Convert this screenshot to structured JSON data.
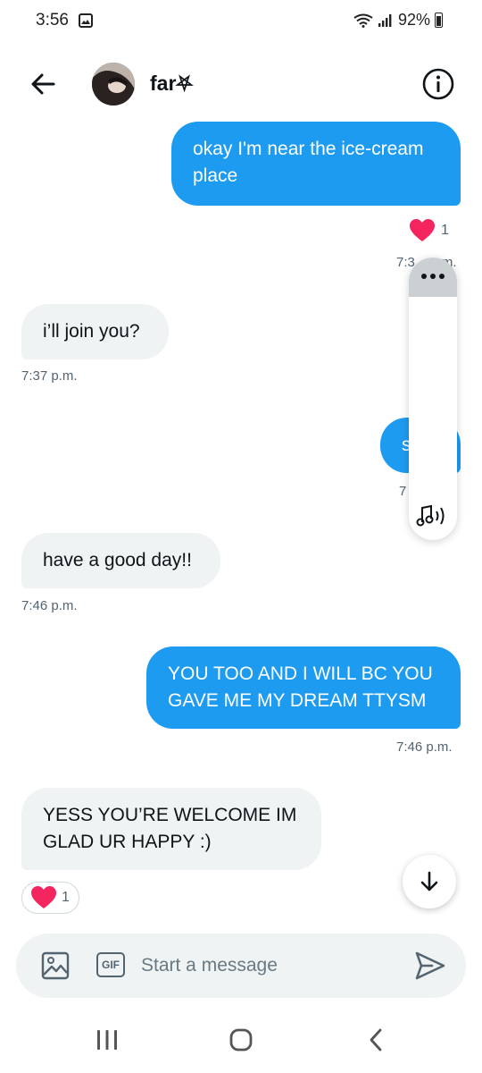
{
  "status_bar": {
    "time": "3:56",
    "battery": "92%"
  },
  "header": {
    "name": "far⛧",
    "back_icon": "arrow-left-icon",
    "info_icon": "info-icon"
  },
  "messages": [
    {
      "text": "okay I'm near the ice-cream place",
      "direction": "outgoing",
      "time": "7:3",
      "time_suffix": "m.",
      "reaction": {
        "icon": "heart-icon",
        "count": "1"
      }
    },
    {
      "text": "i’ll join you?",
      "direction": "incoming",
      "time": "7:37 p.m."
    },
    {
      "text": "s",
      "direction": "outgoing",
      "time": "7"
    },
    {
      "text": "have a good day!!",
      "direction": "incoming",
      "time": "7:46 p.m."
    },
    {
      "text": "YOU TOO AND I WILL BC YOU GAVE ME MY DREAM TTYSM",
      "direction": "outgoing",
      "time": "7:46 p.m."
    },
    {
      "text": "YESS YOU’RE WELCOME IM GLAD UR HAPPY :)",
      "direction": "incoming",
      "reaction": {
        "icon": "heart-icon",
        "count": "1"
      }
    }
  ],
  "composer": {
    "placeholder": "Start a message",
    "gif_label": "GIF"
  },
  "colors": {
    "accent": "#1d9bf0",
    "incoming_bubble": "#eff3f4",
    "heart": "#f91880",
    "text_secondary": "#536471"
  }
}
